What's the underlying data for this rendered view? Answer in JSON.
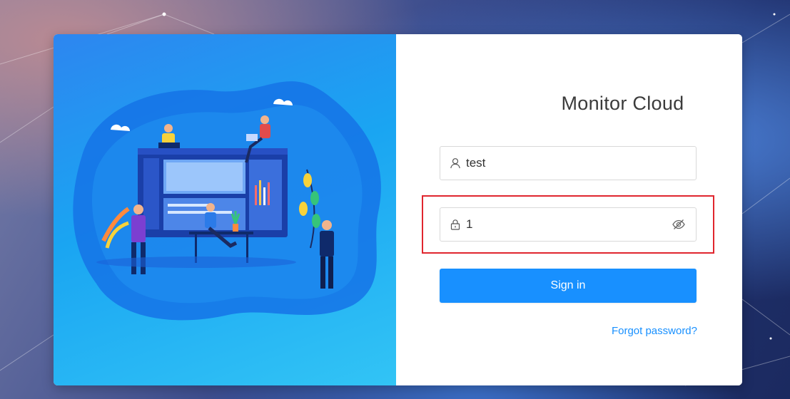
{
  "login": {
    "title": "Monitor Cloud",
    "username": {
      "value": "test",
      "icon": "user-icon"
    },
    "password": {
      "value": "1",
      "icon": "lock-icon",
      "toggle_icon": "eye-hidden-icon"
    },
    "sign_in_label": "Sign in",
    "forgot_password_label": "Forgot password?"
  },
  "colors": {
    "primary": "#1890ff",
    "highlight": "#e0262e",
    "illustration_blue": "#1aa5f2"
  }
}
